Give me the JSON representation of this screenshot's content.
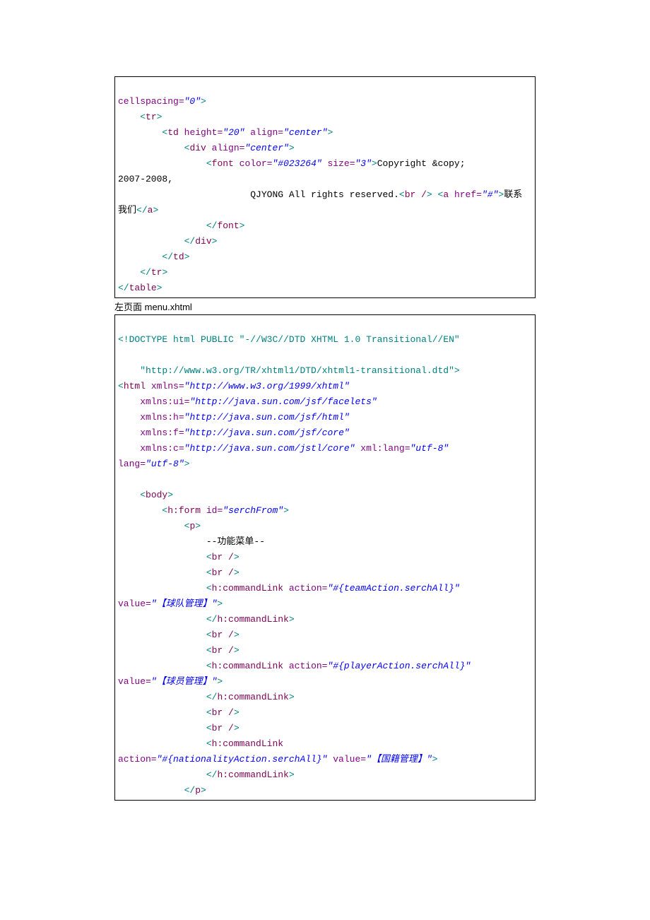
{
  "block1": {
    "l1": {
      "pre": "cellspacing=",
      "q1": "\"0\"",
      "gt": ">"
    },
    "l2": {
      "lt": "<",
      "tag": "tr",
      "gt": ">"
    },
    "l3": {
      "lt": "<",
      "tag": "td",
      "a1k": " height=",
      "a1v": "\"20\"",
      "a2k": " align=",
      "a2v": "\"center\"",
      "gt": ">"
    },
    "l4": {
      "lt": "<",
      "tag": "div",
      "a1k": " align=",
      "a1v": "\"center\"",
      "gt": ">"
    },
    "l5": {
      "lt": "<",
      "tag": "font",
      "a1k": " color=",
      "a1v": "\"#023264\"",
      "a2k": " size=",
      "a2v": "\"3\"",
      "gt": ">",
      "txt": "Copyright &copy;"
    },
    "l6": "2007-2008,",
    "l7": {
      "txt1": "                        QJYONG All rights reserved.",
      "lt1": "<",
      "br": "br /",
      "gt1": ">",
      "sp": " ",
      "lt2": "<",
      "a": "a",
      "hk": " href=",
      "hv": "\"#\"",
      "gt2": ">",
      "txt2": "联系"
    },
    "l8": {
      "txt": "我们",
      "lt": "</",
      "tag": "a",
      "gt": ">"
    },
    "l9": {
      "lt": "</",
      "tag": "font",
      "gt": ">"
    },
    "l10": {
      "lt": "</",
      "tag": "div",
      "gt": ">"
    },
    "l11": {
      "lt": "</",
      "tag": "td",
      "gt": ">"
    },
    "l12": {
      "lt": "</",
      "tag": "tr",
      "gt": ">"
    },
    "l13": {
      "lt": "</",
      "tag": "table",
      "gt": ">"
    }
  },
  "caption": "左页面 menu.xhtml",
  "block2": {
    "l1": {
      "a": "<!",
      "b": "DOCTYPE ",
      "c": "html PUBLIC \"-//W3C//DTD XHTML 1.0 Transitional//EN\""
    },
    "l2": "",
    "l3": {
      "a": "    \"http://www.w3.org/TR/xhtml1/DTD/xhtml1-transitional.dtd\"",
      "b": ">"
    },
    "l4": {
      "lt": "<",
      "tag": "html",
      "ak": " xmlns=",
      "av": "\"http://www.w3.org/1999/xhtml\""
    },
    "l5": {
      "ak": "    xmlns:ui=",
      "av": "\"http://java.sun.com/jsf/facelets\""
    },
    "l6": {
      "ak": "    xmlns:h=",
      "av": "\"http://java.sun.com/jsf/html\""
    },
    "l7": {
      "ak": "    xmlns:f=",
      "av": "\"http://java.sun.com/jsf/core\""
    },
    "l8": {
      "ak": "    xmlns:c=",
      "av": "\"http://java.sun.com/jstl/core\"",
      "bk": " xml:lang=",
      "bv": "\"utf-8\""
    },
    "l9": {
      "ak": "lang=",
      "av": "\"utf-8\"",
      "gt": ">"
    },
    "l10": "",
    "l11": {
      "lt": "<",
      "tag": "body",
      "gt": ">"
    },
    "l12": {
      "lt": "<",
      "tag": "h:form",
      "ak": " id=",
      "av": "\"serchFrom\"",
      "gt": ">"
    },
    "l13": {
      "lt": "<",
      "tag": "p",
      "gt": ">"
    },
    "l14": "                --功能菜单--",
    "l15": {
      "lt": "<",
      "tag": "br /",
      "gt": ">"
    },
    "l16": {
      "lt": "<",
      "tag": "br /",
      "gt": ">"
    },
    "l17": {
      "lt": "<",
      "tag": "h:commandLink",
      "ak": " action=",
      "av": "\"#{teamAction.serchAll}\""
    },
    "l18": {
      "ak": "value=",
      "av": "\"【球队管理】\"",
      "gt": ">"
    },
    "l19": {
      "lt": "</",
      "tag": "h:commandLink",
      "gt": ">"
    },
    "l20": {
      "lt": "<",
      "tag": "br /",
      "gt": ">"
    },
    "l21": {
      "lt": "<",
      "tag": "br /",
      "gt": ">"
    },
    "l22": {
      "lt": "<",
      "tag": "h:commandLink",
      "ak": " action=",
      "av": "\"#{playerAction.serchAll}\""
    },
    "l23": {
      "ak": "value=",
      "av": "\"【球员管理】\"",
      "gt": ">"
    },
    "l24": {
      "lt": "</",
      "tag": "h:commandLink",
      "gt": ">"
    },
    "l25": {
      "lt": "<",
      "tag": "br /",
      "gt": ">"
    },
    "l26": {
      "lt": "<",
      "tag": "br /",
      "gt": ">"
    },
    "l27": {
      "lt": "<",
      "tag": "h:commandLink"
    },
    "l28": {
      "ak": "action=",
      "av": "\"#{nationalityAction.serchAll}\"",
      "bk": " value=",
      "bv": "\"【国籍管理】\"",
      "gt": ">"
    },
    "l29": {
      "lt": "</",
      "tag": "h:commandLink",
      "gt": ">"
    },
    "l30": {
      "lt": "</",
      "tag": "p",
      "gt": ">"
    }
  }
}
